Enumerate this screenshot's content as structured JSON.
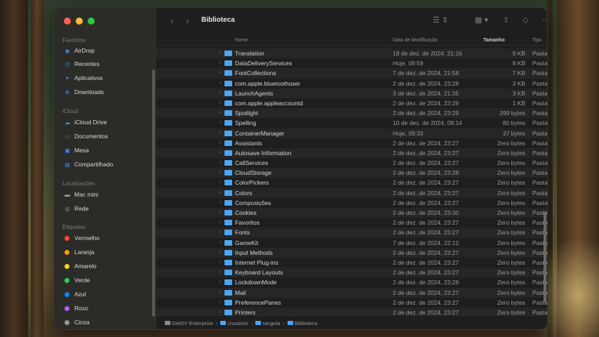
{
  "window": {
    "title": "Biblioteca"
  },
  "toolbar": {
    "back_icon": "chevron-left-icon",
    "forward_icon": "chevron-right-icon",
    "list_view_icon": "list-view-icon",
    "grid_view_icon": "grid-view-icon",
    "share_icon": "share-icon",
    "tag_icon": "tag-icon",
    "more_icon": "more-icon",
    "search_icon": "search-icon"
  },
  "sidebar": {
    "sections": [
      {
        "title": "Favoritos",
        "items": [
          {
            "label": "AirDrop",
            "icon": "airdrop-icon"
          },
          {
            "label": "Recentes",
            "icon": "clock-icon"
          },
          {
            "label": "Aplicativos",
            "icon": "apps-icon"
          },
          {
            "label": "Downloads",
            "icon": "download-icon"
          }
        ]
      },
      {
        "title": "iCloud",
        "items": [
          {
            "label": "iCloud Drive",
            "icon": "cloud-icon"
          },
          {
            "label": "Documentos",
            "icon": "document-icon"
          },
          {
            "label": "Mesa",
            "icon": "desktop-icon"
          },
          {
            "label": "Compartilhado",
            "icon": "shared-folder-icon"
          }
        ]
      },
      {
        "title": "Localizações",
        "items": [
          {
            "label": "Mac mini",
            "icon": "computer-icon"
          },
          {
            "label": "Rede",
            "icon": "network-icon"
          }
        ]
      },
      {
        "title": "Etiquetas",
        "items": [
          {
            "label": "Vermelho",
            "color": "#ff453a"
          },
          {
            "label": "Laranja",
            "color": "#ff9f0a"
          },
          {
            "label": "Amarelo",
            "color": "#ffd60a"
          },
          {
            "label": "Verde",
            "color": "#30d158"
          },
          {
            "label": "Azul",
            "color": "#0a84ff"
          },
          {
            "label": "Roxo",
            "color": "#bf5af2"
          },
          {
            "label": "Cinza",
            "color": "#98989d"
          }
        ]
      }
    ]
  },
  "columns": {
    "name": "Nome",
    "date": "Data de Modificação",
    "size": "Tamanho",
    "kind": "Tipo"
  },
  "files": [
    {
      "name": "Translation",
      "date": "18 de dez. de 2024, 21:16",
      "size": "9 KB",
      "kind": "Pasta"
    },
    {
      "name": "DataDeliveryServices",
      "date": "Hoje, 09:59",
      "size": "8 KB",
      "kind": "Pasta"
    },
    {
      "name": "FontCollections",
      "date": "7 de dez. de 2024, 21:58",
      "size": "7 KB",
      "kind": "Pasta"
    },
    {
      "name": "com.apple.bluetoothuser",
      "date": "2 de dez. de 2024, 23:28",
      "size": "3 KB",
      "kind": "Pasta"
    },
    {
      "name": "LaunchAgents",
      "date": "3 de dez. de 2024, 21:35",
      "size": "3 KB",
      "kind": "Pasta"
    },
    {
      "name": "com.apple.appleaccountd",
      "date": "2 de dez. de 2024, 23:29",
      "size": "1 KB",
      "kind": "Pasta"
    },
    {
      "name": "Spotlight",
      "date": "2 de dez. de 2024, 23:29",
      "size": "299 bytes",
      "kind": "Pasta"
    },
    {
      "name": "Spelling",
      "date": "10 de dez. de 2024, 08:14",
      "size": "80 bytes",
      "kind": "Pasta"
    },
    {
      "name": "ContainerManager",
      "date": "Hoje, 09:33",
      "size": "37 bytes",
      "kind": "Pasta"
    },
    {
      "name": "Assistants",
      "date": "2 de dez. de 2024, 23:27",
      "size": "Zero bytes",
      "kind": "Pasta"
    },
    {
      "name": "Autosave Information",
      "date": "2 de dez. de 2024, 23:27",
      "size": "Zero bytes",
      "kind": "Pasta"
    },
    {
      "name": "CallServices",
      "date": "2 de dez. de 2024, 23:27",
      "size": "Zero bytes",
      "kind": "Pasta"
    },
    {
      "name": "CloudStorage",
      "date": "2 de dez. de 2024, 23:28",
      "size": "Zero bytes",
      "kind": "Pasta"
    },
    {
      "name": "ColorPickers",
      "date": "2 de dez. de 2024, 23:27",
      "size": "Zero bytes",
      "kind": "Pasta"
    },
    {
      "name": "Colors",
      "date": "2 de dez. de 2024, 23:27",
      "size": "Zero bytes",
      "kind": "Pasta"
    },
    {
      "name": "Composições",
      "date": "2 de dez. de 2024, 23:27",
      "size": "Zero bytes",
      "kind": "Pasta"
    },
    {
      "name": "Cookies",
      "date": "2 de dez. de 2024, 23:30",
      "size": "Zero bytes",
      "kind": "Pasta"
    },
    {
      "name": "Favoritos",
      "date": "2 de dez. de 2024, 23:27",
      "size": "Zero bytes",
      "kind": "Pasta"
    },
    {
      "name": "Fonts",
      "date": "2 de dez. de 2024, 23:27",
      "size": "Zero bytes",
      "kind": "Pasta"
    },
    {
      "name": "GameKit",
      "date": "7 de dez. de 2024, 22:12",
      "size": "Zero bytes",
      "kind": "Pasta"
    },
    {
      "name": "Input Methods",
      "date": "2 de dez. de 2024, 23:27",
      "size": "Zero bytes",
      "kind": "Pasta"
    },
    {
      "name": "Internet Plug-ins",
      "date": "2 de dez. de 2024, 23:27",
      "size": "Zero bytes",
      "kind": "Pasta"
    },
    {
      "name": "Keyboard Layouts",
      "date": "2 de dez. de 2024, 23:27",
      "size": "Zero bytes",
      "kind": "Pasta"
    },
    {
      "name": "LockdownMode",
      "date": "2 de dez. de 2024, 23:28",
      "size": "Zero bytes",
      "kind": "Pasta"
    },
    {
      "name": "Mail",
      "date": "2 de dez. de 2024, 23:27",
      "size": "Zero bytes",
      "kind": "Pasta"
    },
    {
      "name": "PreferencePanes",
      "date": "2 de dez. de 2024, 23:27",
      "size": "Zero bytes",
      "kind": "Pasta"
    },
    {
      "name": "Printers",
      "date": "2 de dez. de 2024, 23:27",
      "size": "Zero bytes",
      "kind": "Pasta"
    }
  ],
  "pathbar": [
    "GetDV Enterprise",
    "Usuários",
    "rangela",
    "Biblioteca"
  ]
}
